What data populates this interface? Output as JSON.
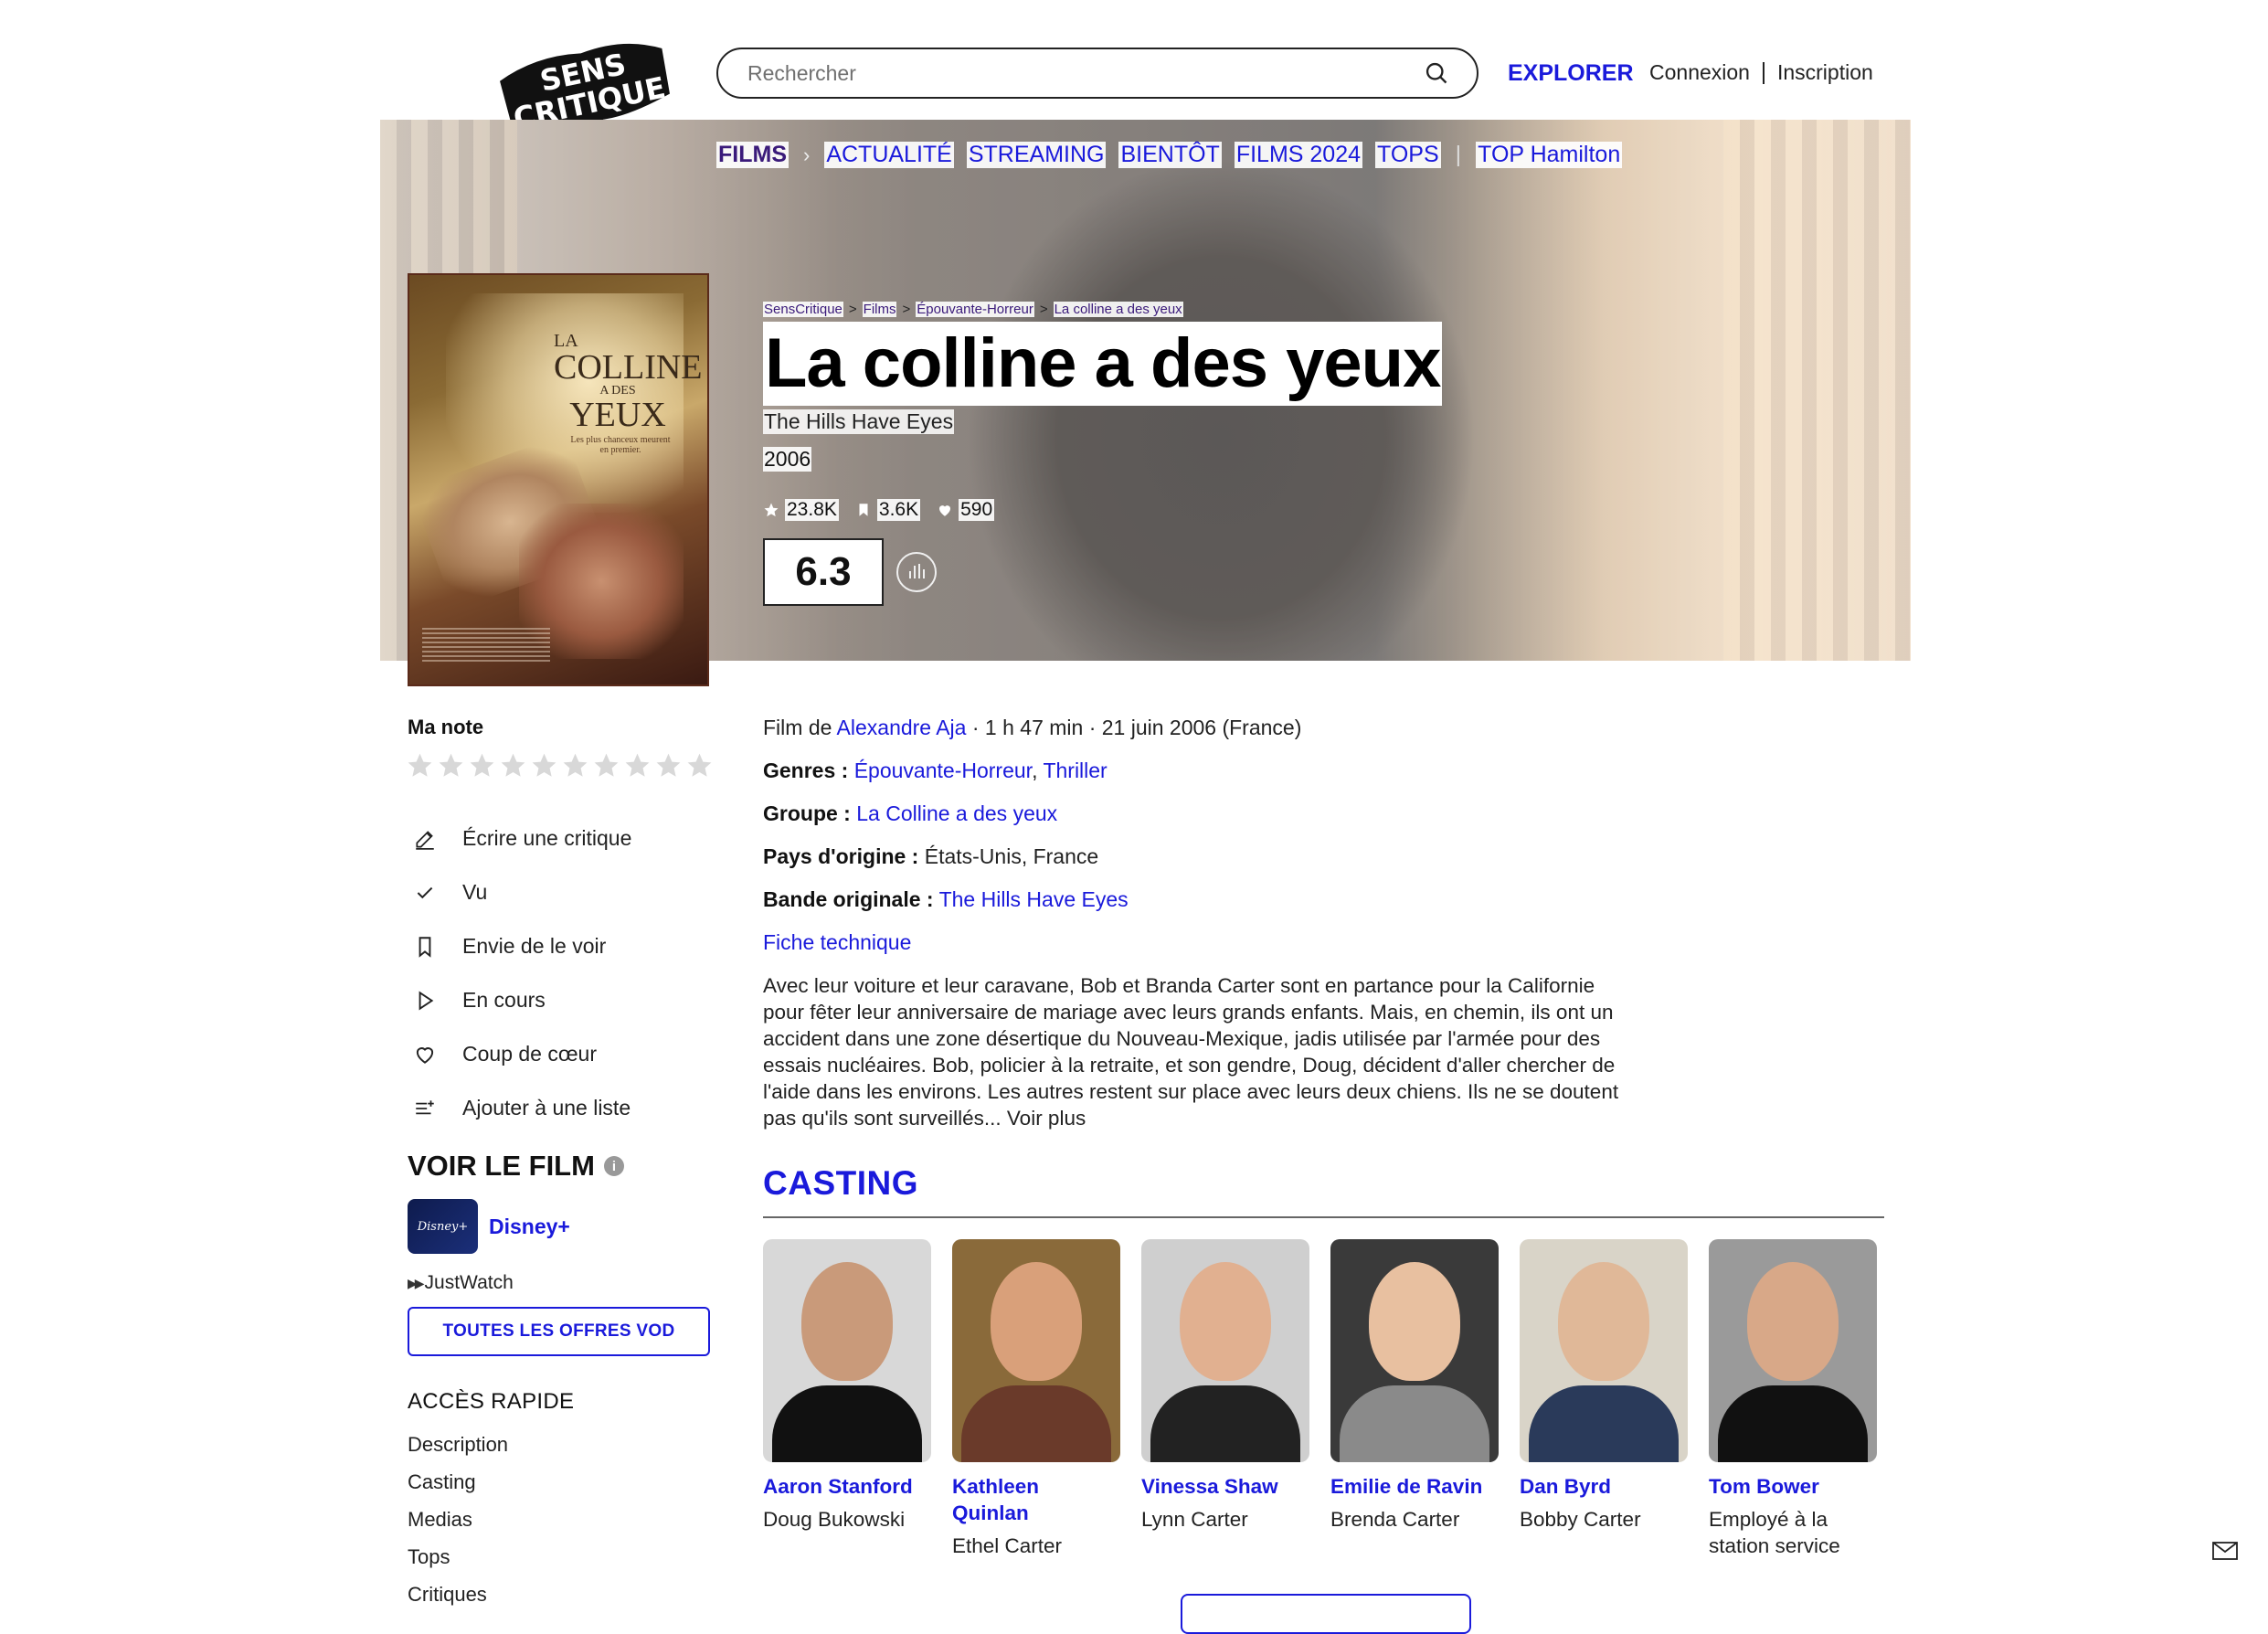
{
  "header": {
    "logo_text": "SENS CRITIQUE",
    "search_placeholder": "Rechercher",
    "explorer": "EXPLORER",
    "login": "Connexion",
    "signup": "Inscription"
  },
  "nav": {
    "films": "FILMS",
    "items": [
      "ACTUALITÉ",
      "STREAMING",
      "BIENTÔT",
      "FILMS 2024",
      "TOPS"
    ],
    "top_hamilton": "TOP Hamilton"
  },
  "poster": {
    "la": "LA",
    "colline": "COLLINE",
    "ades": "A DES",
    "yeux": "YEUX",
    "tagline": "Les plus chanceux meurent en premier."
  },
  "breadcrumb": [
    "SensCritique",
    "Films",
    "Épouvante-Horreur",
    "La colline a des yeux"
  ],
  "movie": {
    "title": "La colline a des yeux",
    "original_title": "The Hills Have Eyes",
    "year": "2006",
    "stats": {
      "ratings": "23.8K",
      "wishlist": "3.6K",
      "favorites": "590"
    },
    "score": "6.3"
  },
  "sidebar": {
    "my_rating_label": "Ma note",
    "star_count": 10,
    "actions": [
      {
        "icon": "pencil-icon",
        "label": "Écrire une critique"
      },
      {
        "icon": "check-icon",
        "label": "Vu"
      },
      {
        "icon": "bookmark-icon",
        "label": "Envie de le voir"
      },
      {
        "icon": "play-icon",
        "label": "En cours"
      },
      {
        "icon": "heart-icon",
        "label": "Coup de cœur"
      },
      {
        "icon": "list-add-icon",
        "label": "Ajouter à une liste"
      }
    ],
    "watch_title": "VOIR LE FILM",
    "info_glyph": "i",
    "provider_logo_text": "Disney+",
    "provider": "Disney+",
    "justwatch": "JustWatch",
    "vod_button": "TOUTES LES OFFRES VOD",
    "quick_access_title": "ACCÈS RAPIDE",
    "quick_links": [
      "Description",
      "Casting",
      "Medias",
      "Tops",
      "Critiques"
    ]
  },
  "details": {
    "film_de": "Film de",
    "director": "Alexandre Aja",
    "meta": "· 1 h 47 min · 21 juin 2006 (France)",
    "genres_label": "Genres :",
    "genre1": "Épouvante-Horreur",
    "genre2": "Thriller",
    "group_label": "Groupe :",
    "group": "La Colline a des yeux",
    "country_label": "Pays d'origine :",
    "country": "États-Unis, France",
    "soundtrack_label": "Bande originale :",
    "soundtrack": "The Hills Have Eyes",
    "fiche": "Fiche technique",
    "synopsis": "Avec leur voiture et leur caravane, Bob et Branda Carter sont en partance pour la Californie pour fêter leur anniversaire de mariage avec leurs grands enfants. Mais, en chemin, ils ont un accident dans une zone désertique du Nouveau-Mexique, jadis utilisée par l'armée pour des essais nucléaires. Bob, policier à la retraite, et son gendre, Doug, décident d'aller chercher de l'aide dans les environs. Les autres restent sur place avec leurs deux chiens. Ils ne se doutent pas qu'ils sont surveillés... Voir plus"
  },
  "casting": {
    "title": "CASTING",
    "actors": [
      {
        "name": "Aaron Stanford",
        "role": "Doug Bukowski",
        "bg": "#d8d8d8",
        "skin": "#c99a7a",
        "clothes": "#111111"
      },
      {
        "name": "Kathleen Quinlan",
        "role": "Ethel Carter",
        "bg": "#8a6a3a",
        "skin": "#d9a07a",
        "clothes": "#6a3a2a"
      },
      {
        "name": "Vinessa Shaw",
        "role": "Lynn Carter",
        "bg": "#cfcfcf",
        "skin": "#e1b090",
        "clothes": "#222222"
      },
      {
        "name": "Emilie de Ravin",
        "role": "Brenda Carter",
        "bg": "#3a3a3a",
        "skin": "#e8c0a0",
        "clothes": "#8a8a8a"
      },
      {
        "name": "Dan Byrd",
        "role": "Bobby Carter",
        "bg": "#d9d4c8",
        "skin": "#e0b898",
        "clothes": "#2a3a5a"
      },
      {
        "name": "Tom Bower",
        "role": "Employé à la station service",
        "bg": "#9a9a9a",
        "skin": "#d8a888",
        "clothes": "#111111"
      }
    ]
  }
}
